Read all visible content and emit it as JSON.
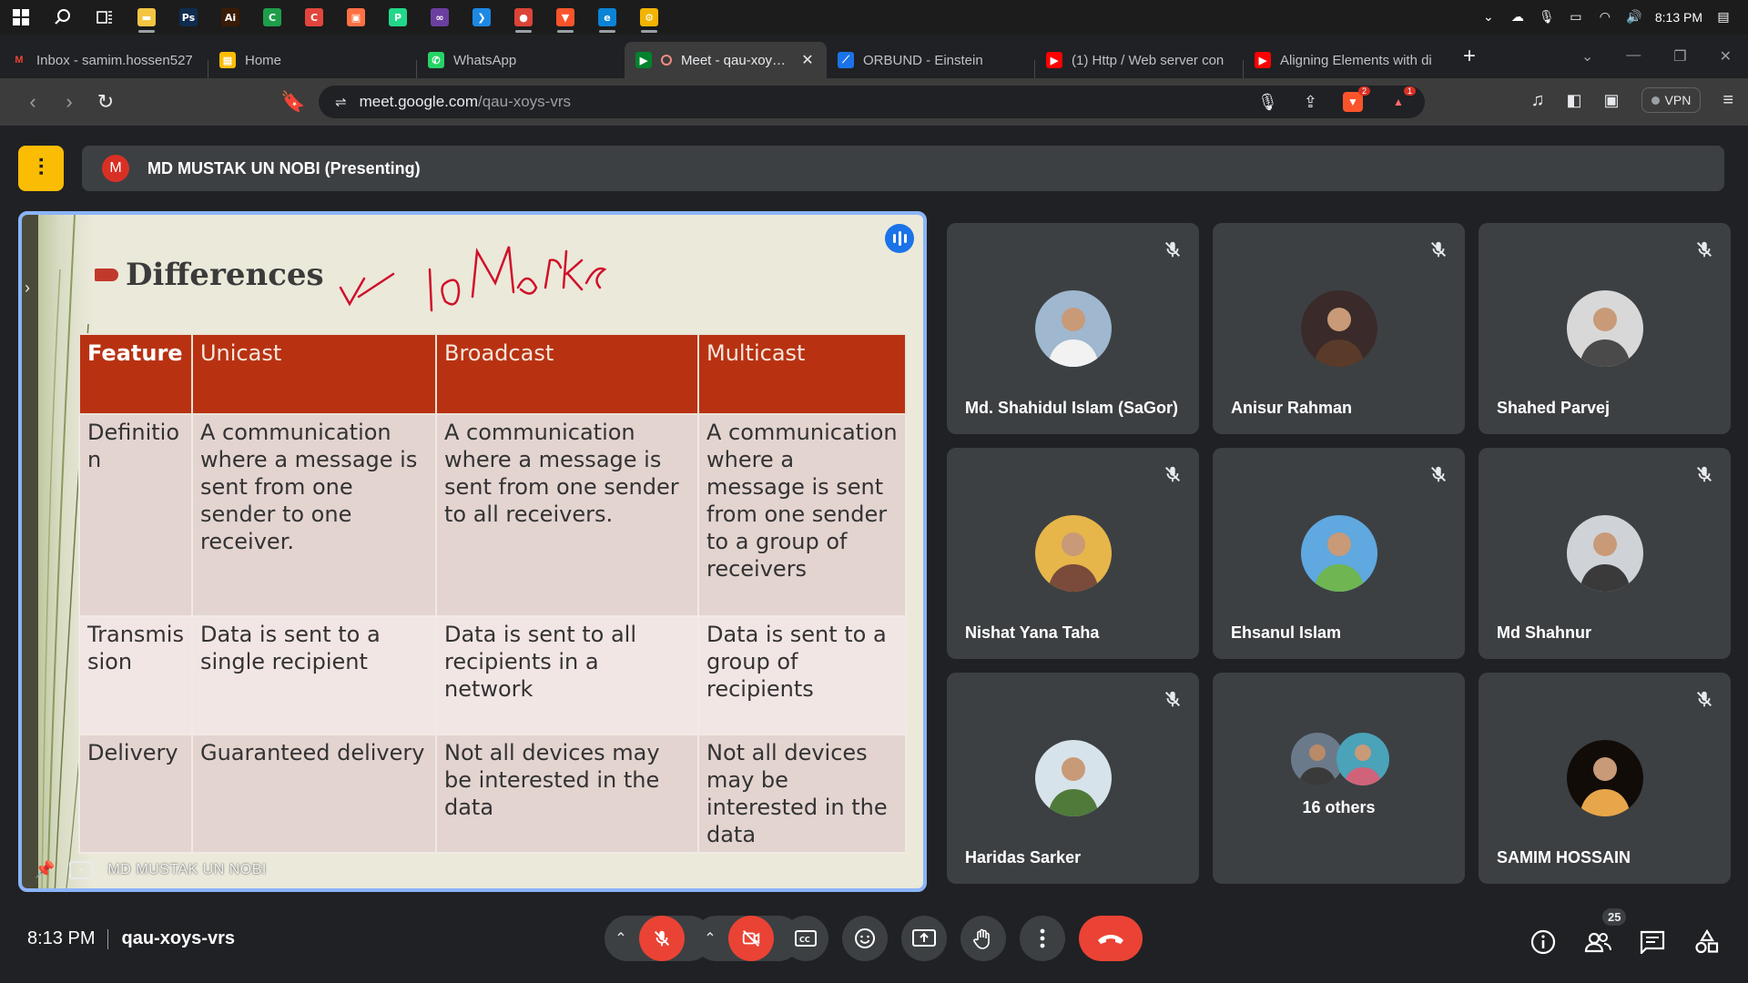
{
  "taskbar": {
    "apps": [
      {
        "name": "windows-start-icon",
        "glyph": "",
        "color": "#1c1c1c"
      },
      {
        "name": "search-icon",
        "glyph": "",
        "color": "#1c1c1c"
      },
      {
        "name": "task-view-icon",
        "glyph": "",
        "color": "#1c1c1c"
      },
      {
        "name": "file-explorer-icon",
        "glyph": "▬",
        "color": "#f4c542"
      },
      {
        "name": "photoshop-icon",
        "glyph": "Ps",
        "color": "#0f2c4f"
      },
      {
        "name": "illustrator-icon",
        "glyph": "Ai",
        "color": "#3a1b06"
      },
      {
        "name": "camtasia-icon",
        "glyph": "C",
        "color": "#1e9e4a"
      },
      {
        "name": "app-red-icon",
        "glyph": "C",
        "color": "#e2453c"
      },
      {
        "name": "app-orange-icon",
        "glyph": "▣",
        "color": "#ff7043"
      },
      {
        "name": "pycharm-icon",
        "glyph": "P",
        "color": "#21d789"
      },
      {
        "name": "visual-studio-icon",
        "glyph": "∞",
        "color": "#6b3fa0"
      },
      {
        "name": "vscode-icon",
        "glyph": "❯",
        "color": "#1e88e5"
      },
      {
        "name": "chrome-icon",
        "glyph": "●",
        "color": "#db4437"
      },
      {
        "name": "brave-icon",
        "glyph": "▼",
        "color": "#fb542b"
      },
      {
        "name": "edge-icon",
        "glyph": "e",
        "color": "#0a84d6"
      },
      {
        "name": "chrome-dev-icon",
        "glyph": "⚙",
        "color": "#f2b400"
      }
    ],
    "time": "8:13 PM"
  },
  "tabs": [
    {
      "label": "Inbox - samim.hossen527",
      "icon": "gmail-icon",
      "color": "#ea4335",
      "glyph": "M"
    },
    {
      "label": "Home",
      "icon": "home-icon",
      "color": "#fbbc04",
      "glyph": "▤"
    },
    {
      "label": "WhatsApp",
      "icon": "whatsapp-icon",
      "color": "#25d366",
      "glyph": "✆"
    },
    {
      "label": "Meet - qau-xoys-v",
      "icon": "meet-icon",
      "color": "#00832d",
      "glyph": "▶"
    },
    {
      "label": "ORBUND - Einstein",
      "icon": "orbund-icon",
      "color": "#1a73e8",
      "glyph": "⟋"
    },
    {
      "label": "(1) Http / Web server con",
      "icon": "youtube-icon",
      "color": "#ff0000",
      "glyph": "▶"
    },
    {
      "label": "Aligning Elements with di",
      "icon": "youtube-icon",
      "color": "#ff0000",
      "glyph": "▶"
    }
  ],
  "address": {
    "host": "meet.google.com",
    "path": "/qau-xoys-vrs"
  },
  "toolbar": {
    "vpn_label": "VPN",
    "brave_badge": "2",
    "alert_badge": "1"
  },
  "meet": {
    "presenter_initial": "M",
    "presenter_banner": "MD MUSTAK UN NOBI (Presenting)",
    "slide": {
      "title": "Differences",
      "annotation": "✓  10 Marks",
      "columns": [
        "Feature",
        "Unicast",
        "Broadcast",
        "Multicast"
      ],
      "rows": [
        [
          "Definitio n",
          "A communication where a message is sent from one sender to one receiver.",
          "A communication where a message is sent from one sender to all receivers.",
          "A communication where a message is sent from one sender to a group of receivers"
        ],
        [
          "Transmis sion",
          "Data is sent to a single recipient",
          "Data is sent to all recipients in a network",
          "Data is sent to a group of recipients"
        ],
        [
          "Delivery",
          "Guaranteed delivery",
          "Not all devices may be interested in the data",
          "Not all devices may be interested in the data"
        ]
      ],
      "presenter_label": "MD MUSTAK UN NOBI"
    },
    "participants": [
      {
        "name": "Md. Shahidul Islam (SaGor)",
        "avatar_bg": "#9fb7cf",
        "fig": "#f2f2f2"
      },
      {
        "name": "Anisur Rahman",
        "avatar_bg": "#3a2a2a",
        "fig": "#5a3b2a"
      },
      {
        "name": "Shahed Parvej",
        "avatar_bg": "#d8d8d8",
        "fig": "#4a4a4a"
      },
      {
        "name": "Nishat Yana Taha",
        "avatar_bg": "#e6b64a",
        "fig": "#7a4b3a"
      },
      {
        "name": "Ehsanul Islam",
        "avatar_bg": "#5fa8e0",
        "fig": "#6fb552"
      },
      {
        "name": "Md Shahnur",
        "avatar_bg": "#cfd3d8",
        "fig": "#3a3a3a"
      },
      {
        "name": "Haridas Sarker",
        "avatar_bg": "#d7e3ea",
        "fig": "#4f7a3a"
      },
      {
        "name": "SAMIM HOSSAIN",
        "avatar_bg": "#120c08",
        "fig": "#e8a64a"
      }
    ],
    "others_label": "16 others",
    "time": "8:13 PM",
    "meeting_code": "qau-xoys-vrs",
    "participant_count": "25"
  }
}
